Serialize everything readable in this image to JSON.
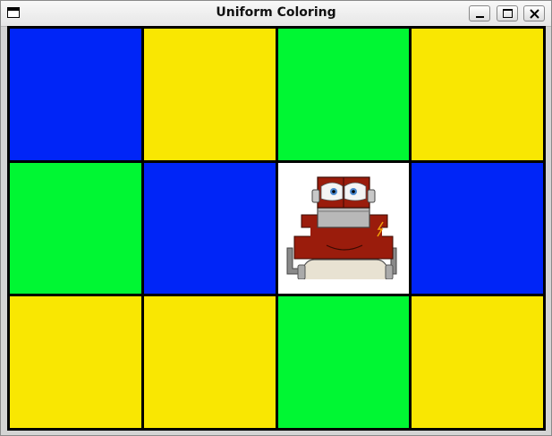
{
  "window": {
    "title": "Uniform Coloring"
  },
  "colors": {
    "blue": "#0025f7",
    "yellow": "#f9e702",
    "green": "#00f733",
    "white": "#ffffff"
  },
  "board": {
    "rows": 3,
    "cols": 4,
    "cells": [
      [
        "blue",
        "yellow",
        "green",
        "yellow"
      ],
      [
        "green",
        "blue",
        "white",
        "blue"
      ],
      [
        "yellow",
        "yellow",
        "green",
        "yellow"
      ]
    ],
    "robot": {
      "row": 1,
      "col": 2,
      "icon": "painter-robot-icon"
    }
  }
}
